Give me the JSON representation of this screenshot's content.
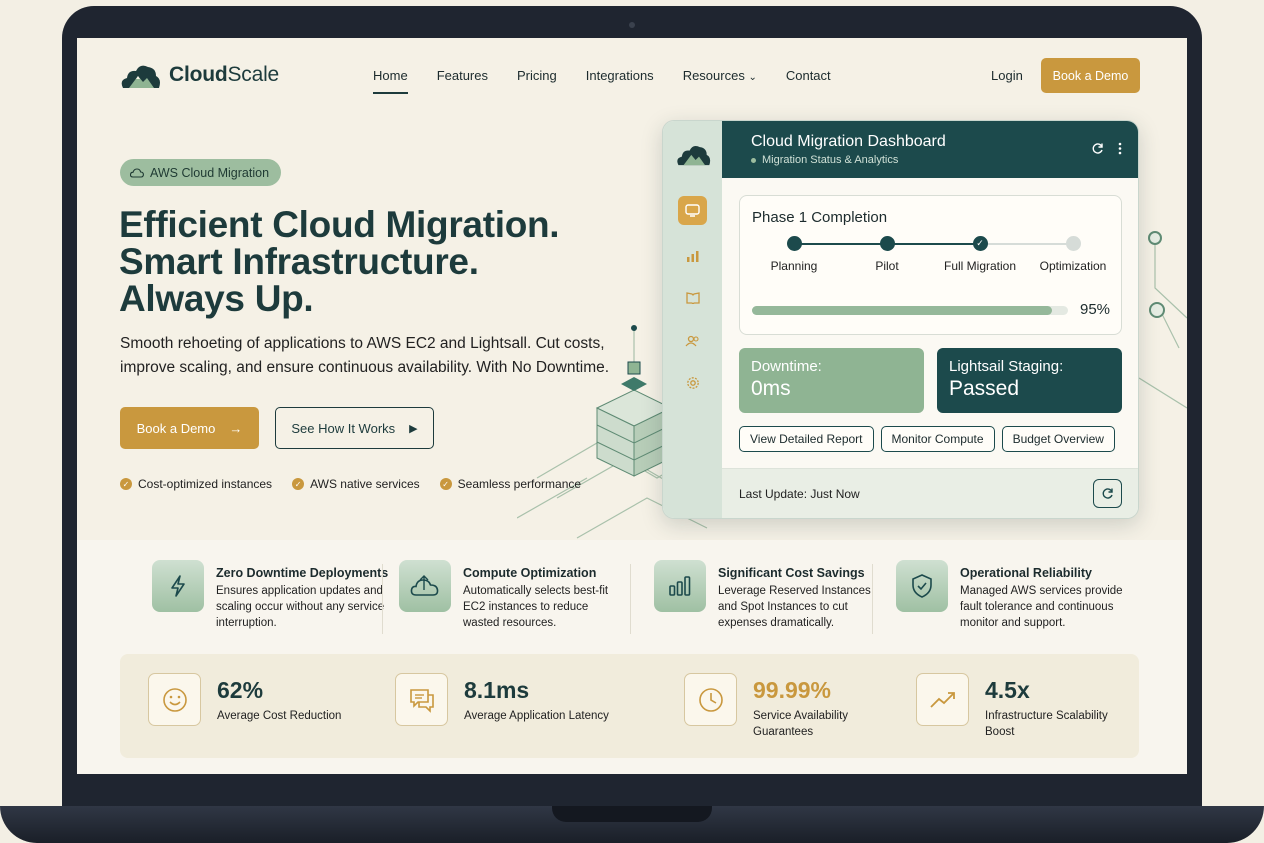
{
  "brand": {
    "name_bold": "Cloud",
    "name_light": "Scale"
  },
  "nav": {
    "items": [
      "Home",
      "Features",
      "Pricing",
      "Integrations",
      "Resources",
      "Contact"
    ],
    "active": "Home",
    "login": "Login",
    "demo": "Book a Demo"
  },
  "hero": {
    "pill": "AWS Cloud Migration",
    "title_lines": [
      "Efficient Cloud Migration.",
      "Smart Infrastructure.",
      "Always Up."
    ],
    "subtitle": "Smooth rehoeting of applications to AWS EC2 and Lightsall. Cut costs, improve scaling, and ensure continuous availability. With No Downtime.",
    "primary_button": "Book a Demo",
    "secondary_button": "See How It Works",
    "checks": [
      "Cost-optimized instances",
      "AWS native services",
      "Seamless performance"
    ]
  },
  "dashboard": {
    "title": "Cloud Migration Dashboard",
    "subtitle": "Migration Status & Analytics",
    "phase_title": "Phase 1 Completion",
    "steps": [
      {
        "label": "Planning",
        "status": "done"
      },
      {
        "label": "Pilot",
        "status": "done"
      },
      {
        "label": "Full Migration",
        "status": "current"
      },
      {
        "label": "Optimization",
        "status": "pending"
      }
    ],
    "progress_percent": 95,
    "progress_label": "95%",
    "stat_a": {
      "label": "Downtime:",
      "value": "0ms"
    },
    "stat_b": {
      "label": "Lightsail Staging:",
      "value": "Passed"
    },
    "buttons": [
      "View Detailed Report",
      "Monitor Compute",
      "Budget Overview"
    ],
    "footer": "Last Update: Just Now",
    "side_icons": [
      "monitor-icon",
      "bar-chart-icon",
      "book-icon",
      "users-icon",
      "settings-icon"
    ]
  },
  "features": [
    {
      "title": "Zero Downtime Deployments",
      "desc": "Ensures application updates and scaling occur without any service interruption.",
      "icon": "lightning-icon"
    },
    {
      "title": "Compute Optimization",
      "desc": "Automatically selects best-fit EC2 instances to reduce wasted resources.",
      "icon": "cloud-upload-icon"
    },
    {
      "title": "Significant Cost Savings",
      "desc": "Leverage Reserved Instances and Spot Instances to cut expenses dramatically.",
      "icon": "bar-chart-icon"
    },
    {
      "title": "Operational Reliability",
      "desc": "Managed AWS services provide fault tolerance and continuous monitor and support.",
      "icon": "shield-check-icon"
    }
  ],
  "metrics": [
    {
      "value": "62%",
      "label": "Average Cost Reduction",
      "icon": "smile-icon",
      "highlight": false
    },
    {
      "value": "8.1ms",
      "label": "Average Application Latency",
      "icon": "chat-icon",
      "highlight": false
    },
    {
      "value": "99.99%",
      "label": "Service Availability Guarantees",
      "icon": "clock-icon",
      "highlight": true
    },
    {
      "value": "4.5x",
      "label": "Infrastructure Scalability Boost",
      "icon": "trend-up-icon",
      "highlight": false
    }
  ],
  "colors": {
    "brand": "#1d3b3c",
    "accent": "#c9983e",
    "sage": "#95b89a",
    "background": "#f5f1e6"
  }
}
